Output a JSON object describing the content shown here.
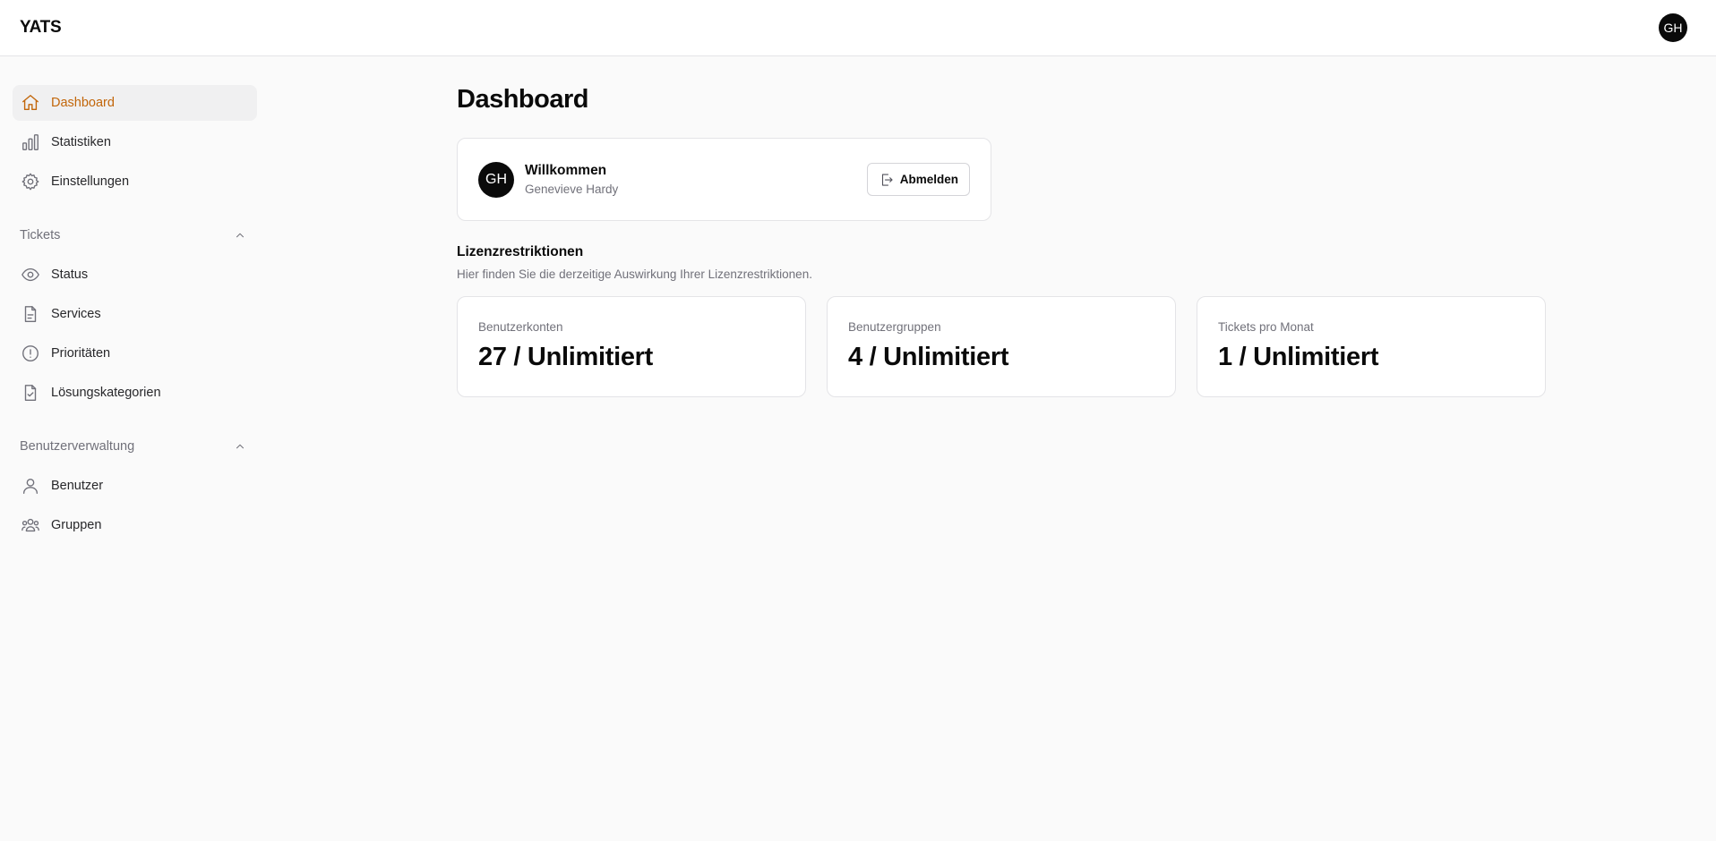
{
  "app": {
    "logo": "YATS",
    "user_initials": "GH"
  },
  "sidebar": {
    "main_items": [
      {
        "label": "Dashboard",
        "icon": "home-icon",
        "active": true
      },
      {
        "label": "Statistiken",
        "icon": "bar-chart-icon"
      },
      {
        "label": "Einstellungen",
        "icon": "gear-icon"
      }
    ],
    "tickets": {
      "title": "Tickets",
      "items": [
        {
          "label": "Status",
          "icon": "eye-icon"
        },
        {
          "label": "Services",
          "icon": "document-icon"
        },
        {
          "label": "Prioritäten",
          "icon": "alert-circle-icon"
        },
        {
          "label": "Lösungskategorien",
          "icon": "document-check-icon"
        }
      ]
    },
    "user_management": {
      "title": "Benutzerverwaltung",
      "items": [
        {
          "label": "Benutzer",
          "icon": "user-icon"
        },
        {
          "label": "Gruppen",
          "icon": "users-group-icon"
        }
      ]
    }
  },
  "main": {
    "title": "Dashboard",
    "welcome": {
      "initials": "GH",
      "title": "Willkommen",
      "name": "Genevieve Hardy",
      "logout_label": "Abmelden"
    },
    "license": {
      "title": "Lizenzrestriktionen",
      "description": "Hier finden Sie die derzeitige Auswirkung Ihrer Lizenzrestriktionen.",
      "cards": [
        {
          "label": "Benutzerkonten",
          "value": "27 / Unlimitiert"
        },
        {
          "label": "Benutzergruppen",
          "value": "4 / Unlimitiert"
        },
        {
          "label": "Tickets pro Monat",
          "value": "1 / Unlimitiert"
        }
      ]
    }
  },
  "colors": {
    "accent": "#c2660a",
    "avatar_bg": "#0a0a0a",
    "border": "#e4e4e7"
  }
}
